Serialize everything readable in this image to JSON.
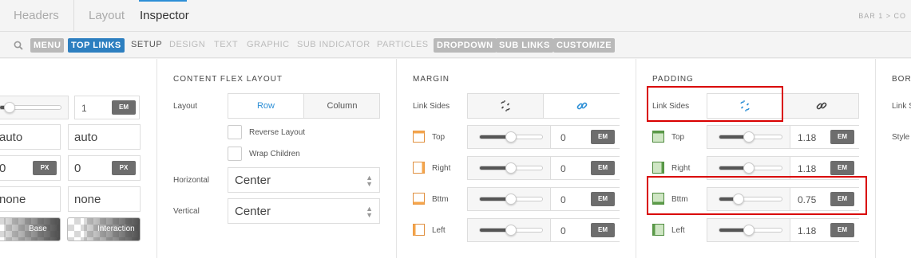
{
  "topbar": {
    "tabs": [
      {
        "label": "Headers"
      },
      {
        "label": "Layout"
      },
      {
        "label": "Inspector"
      }
    ],
    "crumb": "BAR 1  >  CO"
  },
  "subnav": {
    "items": [
      "MENU",
      "TOP LINKS",
      "SETUP",
      "DESIGN",
      "TEXT",
      "GRAPHIC",
      "SUB INDICATOR",
      "PARTICLES",
      "DROPDOWN",
      "SUB LINKS",
      "CUSTOMIZE"
    ]
  },
  "col0": {
    "slider_value": "1",
    "slider_unit": "EM",
    "auto1": "auto",
    "auto2": "auto",
    "px_val1": "0",
    "px_unit1": "PX",
    "px_val2": "0",
    "px_unit2": "PX",
    "none1": "none",
    "none2": "none",
    "swatch_base": "Base",
    "swatch_interaction": "Interaction"
  },
  "flex": {
    "title": "CONTENT FLEX LAYOUT",
    "layout_label": "Layout",
    "row": "Row",
    "column": "Column",
    "reverse": "Reverse Layout",
    "wrap": "Wrap Children",
    "horizontal_label": "Horizontal",
    "horizontal_value": "Center",
    "vertical_label": "Vertical",
    "vertical_value": "Center"
  },
  "margin": {
    "title": "MARGIN",
    "link_label": "Link Sides",
    "rows": [
      {
        "label": "Top",
        "value": "0",
        "unit": "EM"
      },
      {
        "label": "Right",
        "value": "0",
        "unit": "EM"
      },
      {
        "label": "Bttm",
        "value": "0",
        "unit": "EM"
      },
      {
        "label": "Left",
        "value": "0",
        "unit": "EM"
      }
    ]
  },
  "padding": {
    "title": "PADDING",
    "link_label": "Link Sides",
    "rows": [
      {
        "label": "Top",
        "value": "1.18",
        "unit": "EM"
      },
      {
        "label": "Right",
        "value": "1.18",
        "unit": "EM"
      },
      {
        "label": "Bttm",
        "value": "0.75",
        "unit": "EM"
      },
      {
        "label": "Left",
        "value": "1.18",
        "unit": "EM"
      }
    ]
  },
  "border": {
    "title": "BORI",
    "link_label": "Link S",
    "style_label": "Style"
  },
  "colors": {
    "accent": "#2d8fd6",
    "highlight": "#d90000",
    "chip": "#b9b9b9",
    "chip_active": "#2d7fc0"
  }
}
